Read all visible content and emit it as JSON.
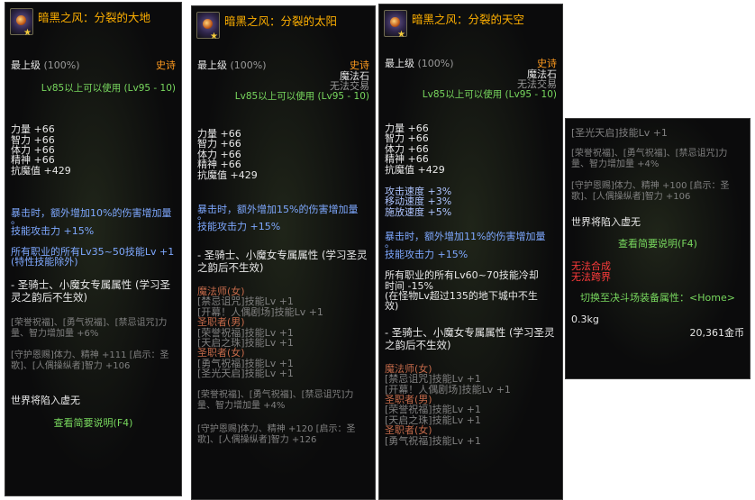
{
  "panels": [
    {
      "title": "暗黑之风：分裂的大地",
      "grade": "最上级",
      "grade_pct": "(100%)",
      "rarity": "史诗",
      "type": "",
      "trade": "",
      "level_req": "Lv85以上可以使用 (Lv95 - 10)",
      "stats": [
        "力量 +66",
        "智力 +66",
        "体力 +66",
        "精神 +66",
        "抗魔值 +429"
      ],
      "effects1": [
        "暴击时，额外增加10%的伤害增加量",
        "。",
        "技能攻击力 +15%"
      ],
      "effects2": [
        "所有职业的所有Lv35~50技能Lv +1",
        "(特性技能除外)"
      ],
      "exclusive": "- 圣骑士、小魔女专属属性 (学习圣灵之韵后不生效)",
      "exclusive_lines": [],
      "bonus1": "[荣誉祝福]、[勇气祝福]、[禁忌诅咒]力量、智力增加量 +6%",
      "bonus2": "[守护恩赐]体力、精神 +111 [启示：圣歌]、[人偶操纵者]智力 +106",
      "world": "世界将陷入虚无",
      "desc_btn": "查看简要说明(F4)"
    },
    {
      "title": "暗黑之风：分裂的太阳",
      "grade": "最上级",
      "grade_pct": "(100%)",
      "rarity": "史诗",
      "type": "魔法石",
      "trade": "无法交易",
      "level_req": "Lv85以上可以使用 (Lv95 - 10)",
      "stats": [
        "力量 +66",
        "智力 +66",
        "体力 +66",
        "精神 +66",
        "抗魔值 +429"
      ],
      "effects1": [
        "暴击时，额外增加15%的伤害增加量",
        "。",
        "技能攻击力 +15%"
      ],
      "exclusive": "- 圣骑士、小魔女专属属性 (学习圣灵之韵后不生效)",
      "class_skills": [
        {
          "t": "魔法师(女)",
          "c": "c-brown"
        },
        {
          "t": "[禁忌诅咒]技能Lv +1",
          "c": "c-dim"
        },
        {
          "t": "[开幕！人偶剧场]技能Lv +1",
          "c": "c-dim"
        },
        {
          "t": "圣职者(男)",
          "c": "c-brown"
        },
        {
          "t": "[荣誉祝福]技能Lv +1",
          "c": "c-dim"
        },
        {
          "t": "[天启之珠]技能Lv +1",
          "c": "c-dim"
        },
        {
          "t": "圣职者(女)",
          "c": "c-brown"
        },
        {
          "t": "[勇气祝福]技能Lv +1",
          "c": "c-dim"
        },
        {
          "t": "[圣光天启]技能Lv +1",
          "c": "c-dim"
        }
      ],
      "bonus1": "[荣誉祝福]、[勇气祝福]、[禁忌诅咒]力量、智力增加量 +4%",
      "bonus2": "[守护恩赐]体力、精神 +120 [启示：圣歌]、[人偶操纵者]智力 +126"
    },
    {
      "title": "暗黑之风：分裂的天空",
      "grade": "最上级",
      "grade_pct": "(100%)",
      "rarity": "史诗",
      "type": "魔法石",
      "trade": "无法交易",
      "level_req": "Lv85以上可以使用 (Lv95 - 10)",
      "stats": [
        "力量 +66",
        "智力 +66",
        "体力 +66",
        "精神 +66",
        "抗魔值 +429"
      ],
      "speeds": [
        "攻击速度 +3%",
        "移动速度 +3%",
        "施放速度 +5%"
      ],
      "effects1": [
        "暴击时，额外增加11%的伤害增加量",
        "。",
        "技能攻击力 +15%"
      ],
      "effects2": [
        "所有职业的所有Lv60~70技能冷却",
        "时间 -15%",
        "(在怪物Lv超过135的地下城中不生",
        "效)"
      ],
      "exclusive": "- 圣骑士、小魔女专属属性 (学习圣灵之韵后不生效)",
      "class_skills": [
        {
          "t": "魔法师(女)",
          "c": "c-brown"
        },
        {
          "t": "[禁忌诅咒]技能Lv +1",
          "c": "c-dim"
        },
        {
          "t": "[开幕！人偶剧场]技能Lv +1",
          "c": "c-dim"
        },
        {
          "t": "圣职者(男)",
          "c": "c-brown"
        },
        {
          "t": "[荣誉祝福]技能Lv +1",
          "c": "c-dim"
        },
        {
          "t": "[天启之珠]技能Lv +1",
          "c": "c-dim"
        },
        {
          "t": "圣职者(女)",
          "c": "c-brown"
        },
        {
          "t": "[勇气祝福]技能Lv +1",
          "c": "c-dim"
        }
      ]
    },
    {
      "skill_line": "[圣光天启]技能Lv +1",
      "bonus1": "[荣誉祝福]、[勇气祝福]、[禁忌诅咒]力量、智力增加量 +4%",
      "bonus2": "[守护恩赐]体力、精神 +100 [启示：圣歌]、[人偶操纵者]智力 +106",
      "world": "世界将陷入虚无",
      "desc_btn": "查看简要说明(F4)",
      "no_synth": "无法合成",
      "no_cross": "无法跨界",
      "switch": "切换至决斗场装备属性：<Home>",
      "weight": "0.3kg",
      "price": "20,361金币"
    }
  ],
  "colors": {
    "title": "#ffb000",
    "rarity": "#ff9b1f",
    "green": "#78d85e",
    "blue": "#7ea8ff",
    "red": "#ff3b3b"
  }
}
